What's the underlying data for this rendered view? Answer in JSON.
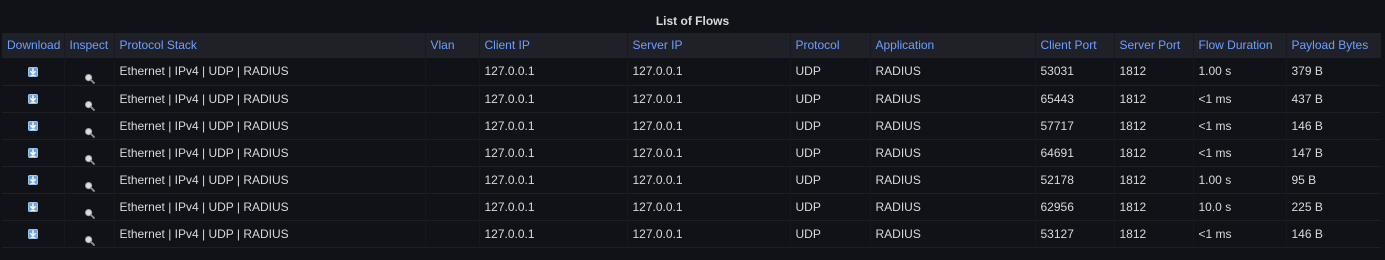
{
  "panel": {
    "title": "List of Flows"
  },
  "columns": [
    "Download",
    "Inspect",
    "Protocol Stack",
    "Vlan",
    "Client IP",
    "Server IP",
    "Protocol",
    "Application",
    "Client Port",
    "Server Port",
    "Flow Duration",
    "Payload Bytes"
  ],
  "icons": {
    "download": "download-icon",
    "inspect": "magnifier-icon"
  },
  "rows": [
    {
      "protocol_stack": "Ethernet | IPv4 | UDP | RADIUS",
      "vlan": "",
      "client_ip": "127.0.0.1",
      "server_ip": "127.0.0.1",
      "protocol": "UDP",
      "application": "RADIUS",
      "client_port": "53031",
      "server_port": "1812",
      "flow_duration": "1.00 s",
      "payload_bytes": "379 B"
    },
    {
      "protocol_stack": "Ethernet | IPv4 | UDP | RADIUS",
      "vlan": "",
      "client_ip": "127.0.0.1",
      "server_ip": "127.0.0.1",
      "protocol": "UDP",
      "application": "RADIUS",
      "client_port": "65443",
      "server_port": "1812",
      "flow_duration": "<1 ms",
      "payload_bytes": "437 B"
    },
    {
      "protocol_stack": "Ethernet | IPv4 | UDP | RADIUS",
      "vlan": "",
      "client_ip": "127.0.0.1",
      "server_ip": "127.0.0.1",
      "protocol": "UDP",
      "application": "RADIUS",
      "client_port": "57717",
      "server_port": "1812",
      "flow_duration": "<1 ms",
      "payload_bytes": "146 B"
    },
    {
      "protocol_stack": "Ethernet | IPv4 | UDP | RADIUS",
      "vlan": "",
      "client_ip": "127.0.0.1",
      "server_ip": "127.0.0.1",
      "protocol": "UDP",
      "application": "RADIUS",
      "client_port": "64691",
      "server_port": "1812",
      "flow_duration": "<1 ms",
      "payload_bytes": "147 B"
    },
    {
      "protocol_stack": "Ethernet | IPv4 | UDP | RADIUS",
      "vlan": "",
      "client_ip": "127.0.0.1",
      "server_ip": "127.0.0.1",
      "protocol": "UDP",
      "application": "RADIUS",
      "client_port": "52178",
      "server_port": "1812",
      "flow_duration": "1.00 s",
      "payload_bytes": "95 B"
    },
    {
      "protocol_stack": "Ethernet | IPv4 | UDP | RADIUS",
      "vlan": "",
      "client_ip": "127.0.0.1",
      "server_ip": "127.0.0.1",
      "protocol": "UDP",
      "application": "RADIUS",
      "client_port": "62956",
      "server_port": "1812",
      "flow_duration": "10.0 s",
      "payload_bytes": "225 B"
    },
    {
      "protocol_stack": "Ethernet | IPv4 | UDP | RADIUS",
      "vlan": "",
      "client_ip": "127.0.0.1",
      "server_ip": "127.0.0.1",
      "protocol": "UDP",
      "application": "RADIUS",
      "client_port": "53127",
      "server_port": "1812",
      "flow_duration": "<1 ms",
      "payload_bytes": "146 B"
    }
  ]
}
